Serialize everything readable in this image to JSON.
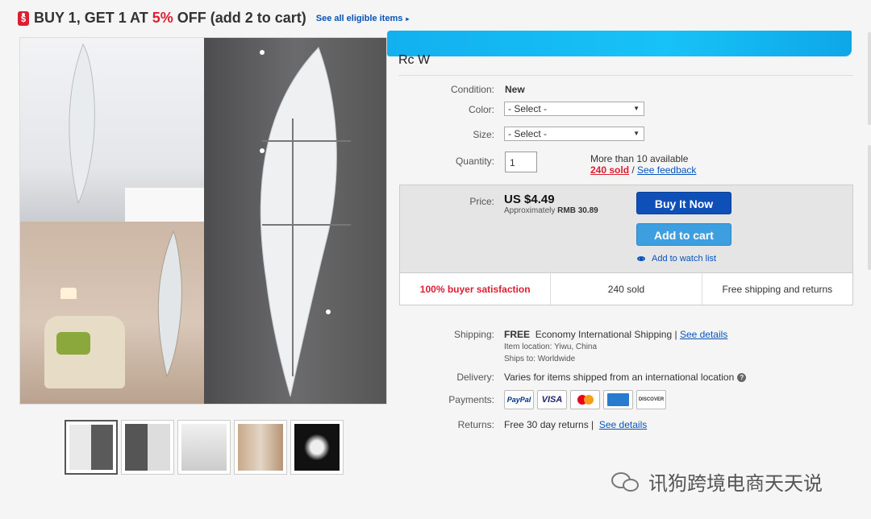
{
  "promo": {
    "tag": "$",
    "text_prefix": "BUY 1, GET 1 AT ",
    "percent": "5%",
    "text_suffix": " OFF (add 2 to cart)",
    "link": "See all eligible items",
    "arrow": "▸"
  },
  "title": {
    "visible_remnant": "Rc                    W"
  },
  "fields": {
    "condition_label": "Condition:",
    "condition_value": "New",
    "color_label": "Color:",
    "color_value": "- Select -",
    "size_label": "Size:",
    "size_value": "- Select -",
    "quantity_label": "Quantity:",
    "quantity_value": "1",
    "available": "More than 10 available",
    "sold_link": "240 sold",
    "separator": " / ",
    "feedback_link": "See feedback"
  },
  "price": {
    "label": "Price:",
    "value": "US $4.49",
    "approx_prefix": "Approximately ",
    "approx_value": "RMB 30.89",
    "buy_now": "Buy It Now",
    "add_to_cart": "Add to cart",
    "watch": "Add to watch list"
  },
  "stats": [
    "100% buyer satisfaction",
    "240 sold",
    "Free shipping and returns"
  ],
  "shipping": {
    "label": "Shipping:",
    "free": "FREE",
    "method": "Economy International Shipping",
    "sep": " | ",
    "details_link": "See details",
    "location": "Item location:  Yiwu, China",
    "ships_to": "Ships to:  Worldwide"
  },
  "delivery": {
    "label": "Delivery:",
    "value": "Varies for items shipped from an international location",
    "info": "?"
  },
  "payments": {
    "label": "Payments:",
    "methods": [
      "PayPal",
      "VISA",
      "MasterCard",
      "American Express",
      "DISCOVER"
    ]
  },
  "returns": {
    "label": "Returns:",
    "value": "Free 30 day returns",
    "sep": " | ",
    "details_link": "See details"
  },
  "watermark": {
    "text": "讯狗跨境电商天天说"
  },
  "colors": {
    "red": "#dd1e31",
    "link": "#0654ba",
    "buy": "#0f4fb8",
    "cart": "#3e9fe0"
  }
}
